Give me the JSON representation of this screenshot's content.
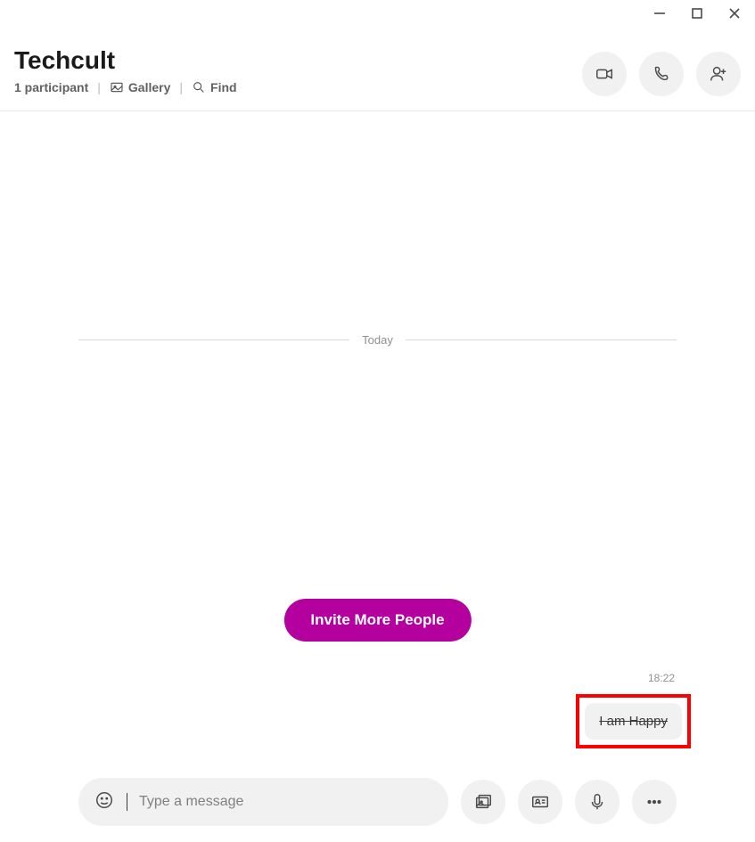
{
  "window": {
    "minimize_icon": "minimize",
    "maximize_icon": "maximize",
    "close_icon": "close"
  },
  "header": {
    "title": "Techcult",
    "participants": "1 participant",
    "gallery_label": "Gallery",
    "find_label": "Find"
  },
  "actions": {
    "video_icon": "video-camera",
    "phone_icon": "phone",
    "add_icon": "add-user"
  },
  "chat": {
    "date_label": "Today",
    "invite_label": "Invite More People",
    "message_time": "18:22",
    "message_text": "I am Happy"
  },
  "composer": {
    "placeholder": "Type a message",
    "emoji_icon": "emoji",
    "photo_icon": "photo",
    "contact_icon": "contact-card",
    "mic_icon": "microphone",
    "more_icon": "more"
  },
  "colors": {
    "accent": "#b4009e",
    "highlight": "#ff0000"
  }
}
